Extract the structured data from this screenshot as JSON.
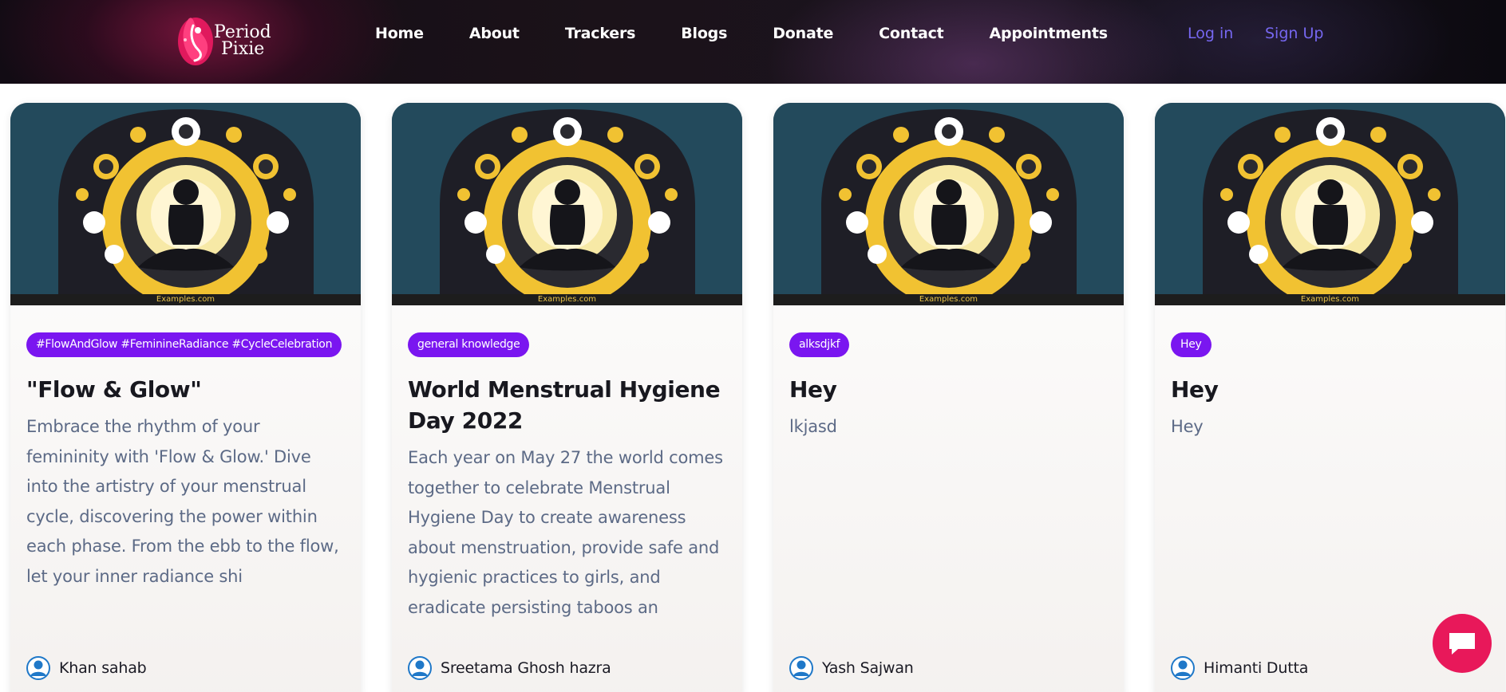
{
  "brand": {
    "line1": "Period",
    "line2": "Pixie",
    "accent": "#e8185a"
  },
  "nav": {
    "links": [
      "Home",
      "About",
      "Trackers",
      "Blogs",
      "Donate",
      "Contact",
      "Appointments"
    ],
    "login": "Log in",
    "signup": "Sign Up"
  },
  "image_caption": "Examples.com",
  "cards": [
    {
      "tag": "#FlowAndGlow #FeminineRadiance #CycleCelebration",
      "title": "\"Flow & Glow\"",
      "excerpt": "Embrace the rhythm of your femininity with 'Flow & Glow.' Dive into the artistry of your menstrual cycle, discovering the power within each phase. From the ebb to the flow, let your inner radiance shi",
      "author": "Khan sahab"
    },
    {
      "tag": "general knowledge",
      "title": "World Menstrual Hygiene Day 2022",
      "excerpt": "Each year on May 27 the world comes together to celebrate Menstrual Hygiene Day to create awareness about menstruation, provide safe and hygienic practices to girls, and eradicate persisting taboos an",
      "author": "Sreetama Ghosh hazra"
    },
    {
      "tag": "alksdjkf",
      "title": "Hey",
      "excerpt": "lkjasd",
      "author": "Yash Sajwan"
    },
    {
      "tag": "Hey",
      "title": "Hey",
      "excerpt": "Hey",
      "author": "Himanti Dutta"
    }
  ],
  "icons": {
    "avatar": "user-avatar-icon",
    "chat": "chat-bubble-icon"
  },
  "colors": {
    "tag_bg": "#7a16f0",
    "auth_link": "#7667f0",
    "excerpt": "#5c6a86"
  }
}
